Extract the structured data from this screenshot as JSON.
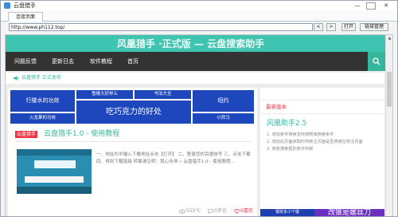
{
  "window": {
    "title": "云盘猎手",
    "minimize": "—",
    "maximize": "□",
    "close": "✕"
  },
  "tabbar": {
    "tab": "连接页面"
  },
  "addressbar": {
    "url": "http://www.ph112.top/",
    "back": "<",
    "forward": ">",
    "open": "打开",
    "link_manage": "链接管理"
  },
  "site": {
    "banner": "风凰猎手 ·正式版 — 云盘搜索助手",
    "nav": [
      "问题反馈",
      "更新日志",
      "软件教程",
      "首页"
    ],
    "announcement": "云盘猎手 正式发布",
    "grid": {
      "row1_left": "行楼水的功效",
      "row1_top": "雪楼大好样么",
      "row1_top2": "书法大全",
      "row1_right": "纽约",
      "center": "吃巧克力的好处",
      "row2_left": "火龙果的功效",
      "row2_right": "小拜马"
    },
    "post": {
      "badge": "云盘猎手",
      "title": "云盘猎手1.0 - 使用教程",
      "excerpt": "一、地址栏中输入下载地址点击【打开】 二、登录您的百度帐号 三、点击下载 四、得到下载链接 转载请注明：我心永恒 » 云盘猎手1.0 - 使用教程...",
      "views": "555℃",
      "comments": "0评论",
      "likes": "0喜欢"
    },
    "sidebar": {
      "section_title": "最新版本",
      "head": "风凰助手2.5",
      "lines": [
        "1. 增加条件搜索支持按照库搜索条件",
        "2. 增加后页面获取时判断主页面是否修被在校注页面",
        "3. 修复搜索框的条件判断"
      ],
      "promo_left": "钢琴多少个键",
      "promo_right": "改锥是螺丝刀"
    }
  },
  "colors": {
    "accent": "#36b79d",
    "nav": "#333333",
    "tile": "#1f47bd",
    "badge": "#ee3344",
    "promo": "#6b2fc0"
  }
}
